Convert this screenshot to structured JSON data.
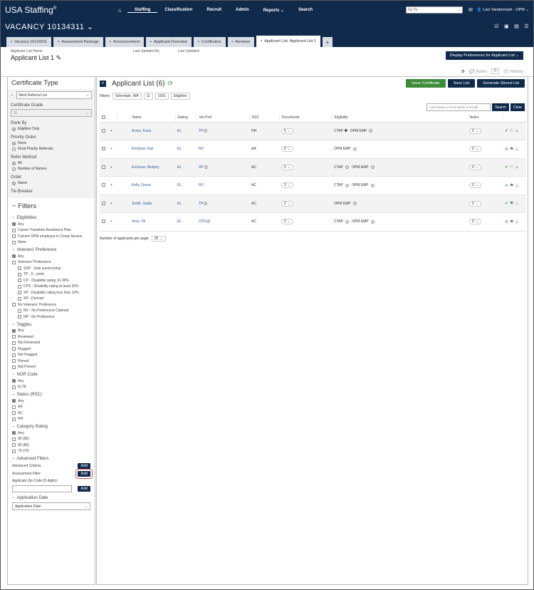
{
  "header": {
    "logo": "USA Staffing",
    "nav": [
      "Staffing",
      "Classification",
      "Recruit",
      "Admin",
      "Reports",
      "Search"
    ],
    "goto_placeholder": "Go To",
    "user": "Laci Vandermark - OPM"
  },
  "vacancy": {
    "title": "VACANCY 10134311"
  },
  "tabs": [
    "Vacancy 10134311",
    "Assessment Package",
    "Announcement",
    "Applicant Overview",
    "Certificates",
    "Reviews",
    "Applicant List: Applicant List 1"
  ],
  "info": {
    "name_label": "Applicant List Name",
    "name": "Applicant List 1",
    "updated_by_label": "Last Updated By",
    "updated_label": "Last Updated",
    "display_prefs": "Display Preferences for Applicant List"
  },
  "notes": {
    "notes_label": "Notes",
    "notes_count": "0",
    "history_label": "History"
  },
  "certificate": {
    "title": "Certificate Type",
    "type_value": "Merit Referral List",
    "grade_label": "Certificate Grade",
    "grade_value": "11",
    "rank_label": "Rank By",
    "rank_opt": "Eligibles Only",
    "priority_label": "Priority Order",
    "priority_opts": [
      "None",
      "Float Priority Referrals"
    ],
    "refer_label": "Refer Method",
    "refer_opts": [
      "All",
      "Number of Names"
    ],
    "order_label": "Order",
    "order_opt": "Name",
    "tie_label": "Tie Breaker"
  },
  "filters": {
    "title": "Filters",
    "elig": {
      "label": "Eligibilities",
      "items": [
        "Any",
        "Career Transition Assistance Plan",
        "Current OPM employee in Comp Service",
        "None"
      ]
    },
    "vet": {
      "label": "Veterans' Preference",
      "any": "Any",
      "vp": "Veterans' Preference",
      "sub": [
        "SSP - Sole survivorship",
        "TP - 5 - point",
        "CP - Disability rating 10-30%",
        "CPS - Disability rating at least 30%",
        "XP - Disability rating less than 10%",
        "XP - Derived"
      ],
      "nvp": "No Veterans' Preference",
      "nsub": [
        "NV - No Preference Claimed",
        "NP - No Preference"
      ]
    },
    "toggles": {
      "label": "Toggles",
      "items": [
        "Any",
        "Reviewed",
        "Not Reviewed",
        "Flagged",
        "Not Flagged",
        "Pinned",
        "Not Pinned"
      ]
    },
    "nor": {
      "label": "NOR Code",
      "items": [
        "Any",
        "ELTE"
      ]
    },
    "status": {
      "label": "Status (RSC)",
      "items": [
        "Any",
        "AA",
        "AC",
        "HH"
      ]
    },
    "cat": {
      "label": "Category Rating",
      "items": [
        "Any",
        "95 (95)",
        "80 (80)",
        "70 (70)"
      ]
    },
    "adv": {
      "label": "Advanced Filters",
      "criteria": "Advanced Criteria:",
      "assessment": "Assessment Filter:",
      "zip": "Applicant Zip Code (5 digits):",
      "add": "Add"
    },
    "appdate": {
      "label": "Application Date",
      "value": "Application Date"
    }
  },
  "list": {
    "title": "Applicant List (6)",
    "issue": "Issue Certificate",
    "save": "Save List",
    "gen": "Generate Stored List",
    "filters_label": "Filters:",
    "chips": [
      "Silverdale, WA",
      "11",
      "0201",
      "Eligibles"
    ],
    "search_placeholder": "Last Name or First Name or Email",
    "search": "Search",
    "clear": "Clear",
    "cols": [
      "Name",
      "Rating",
      "Vet Pref",
      "RSC",
      "Documents",
      "Eligibility",
      "Notes"
    ],
    "rows": [
      {
        "name": "Acres, Kona",
        "rating": "EL",
        "vet": "TP",
        "rsc": "HH",
        "docs": "5",
        "elig": [
          "CTAP",
          "OPM EMP"
        ],
        "notes": "0"
      },
      {
        "name": "Erickson, Kali",
        "rating": "EL",
        "vet": "NV",
        "rsc": "AA",
        "docs": "0",
        "elig": [
          "OPM EMP"
        ],
        "notes": "0"
      },
      {
        "name": "Erickson, Murphy",
        "rating": "EL",
        "vet": "XP",
        "rsc": "AC",
        "docs": "2",
        "elig": [
          "CTAP",
          "OPM EMP"
        ],
        "notes": "0"
      },
      {
        "name": "Kelly, Grace",
        "rating": "EL",
        "vet": "NV",
        "rsc": "AC",
        "docs": "2",
        "elig": [
          "CTAP",
          "OPM EMP"
        ],
        "notes": "0"
      },
      {
        "name": "Smith, Sadie",
        "rating": "EL",
        "vet": "TP",
        "rsc": "AC",
        "docs": "2",
        "elig": [
          "OPM EMP"
        ],
        "notes": "0"
      },
      {
        "name": "Vera, Oli",
        "rating": "EL",
        "vet": "CPS",
        "rsc": "AC",
        "docs": "2",
        "elig": [
          "CTAP",
          "OPM EMP"
        ],
        "notes": "0"
      }
    ],
    "per_page_label": "Number of applicants per page:",
    "per_page": "25"
  }
}
